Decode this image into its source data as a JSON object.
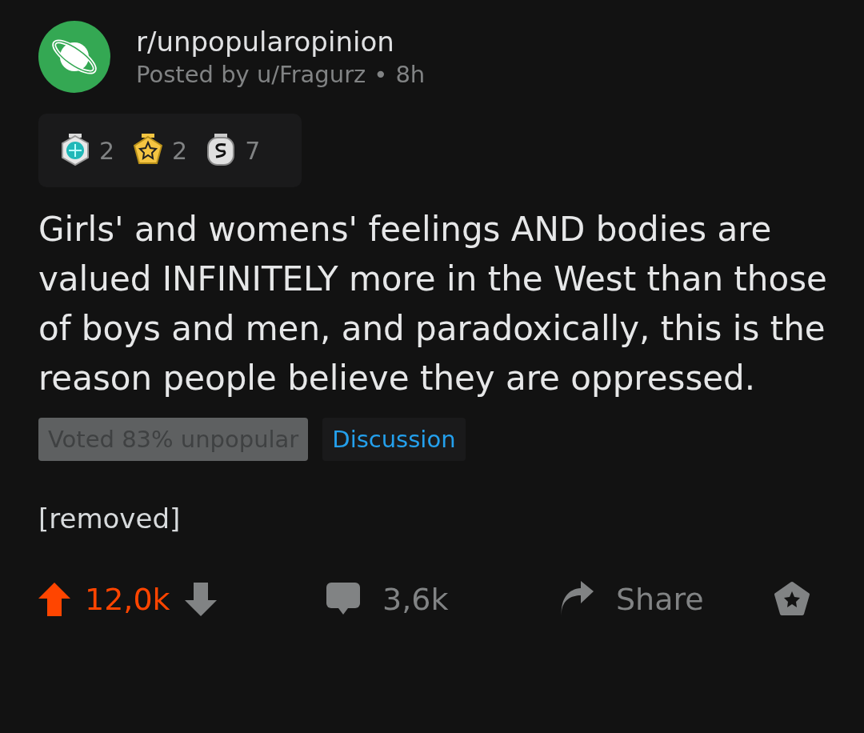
{
  "post": {
    "subreddit": "r/unpopularopinion",
    "byline": "Posted by u/Fragurz",
    "separator": "•",
    "age": "8h"
  },
  "awards": [
    {
      "kind": "gem",
      "count": "2"
    },
    {
      "kind": "star",
      "count": "2"
    },
    {
      "kind": "silver",
      "count": "7"
    }
  ],
  "title": "Girls' and womens' feelings AND bodies are valued INFINITELY more in the West than those of boys and men, and paradoxically, this is the reason people believe they are oppressed.",
  "flairs": [
    {
      "kind": "muted",
      "label": "Voted 83% unpopular"
    },
    {
      "kind": "link",
      "label": "Discussion"
    }
  ],
  "body": "[removed]",
  "actions": {
    "upvoted": true,
    "score": "12,0k",
    "comments": "3,6k",
    "share": "Share"
  }
}
